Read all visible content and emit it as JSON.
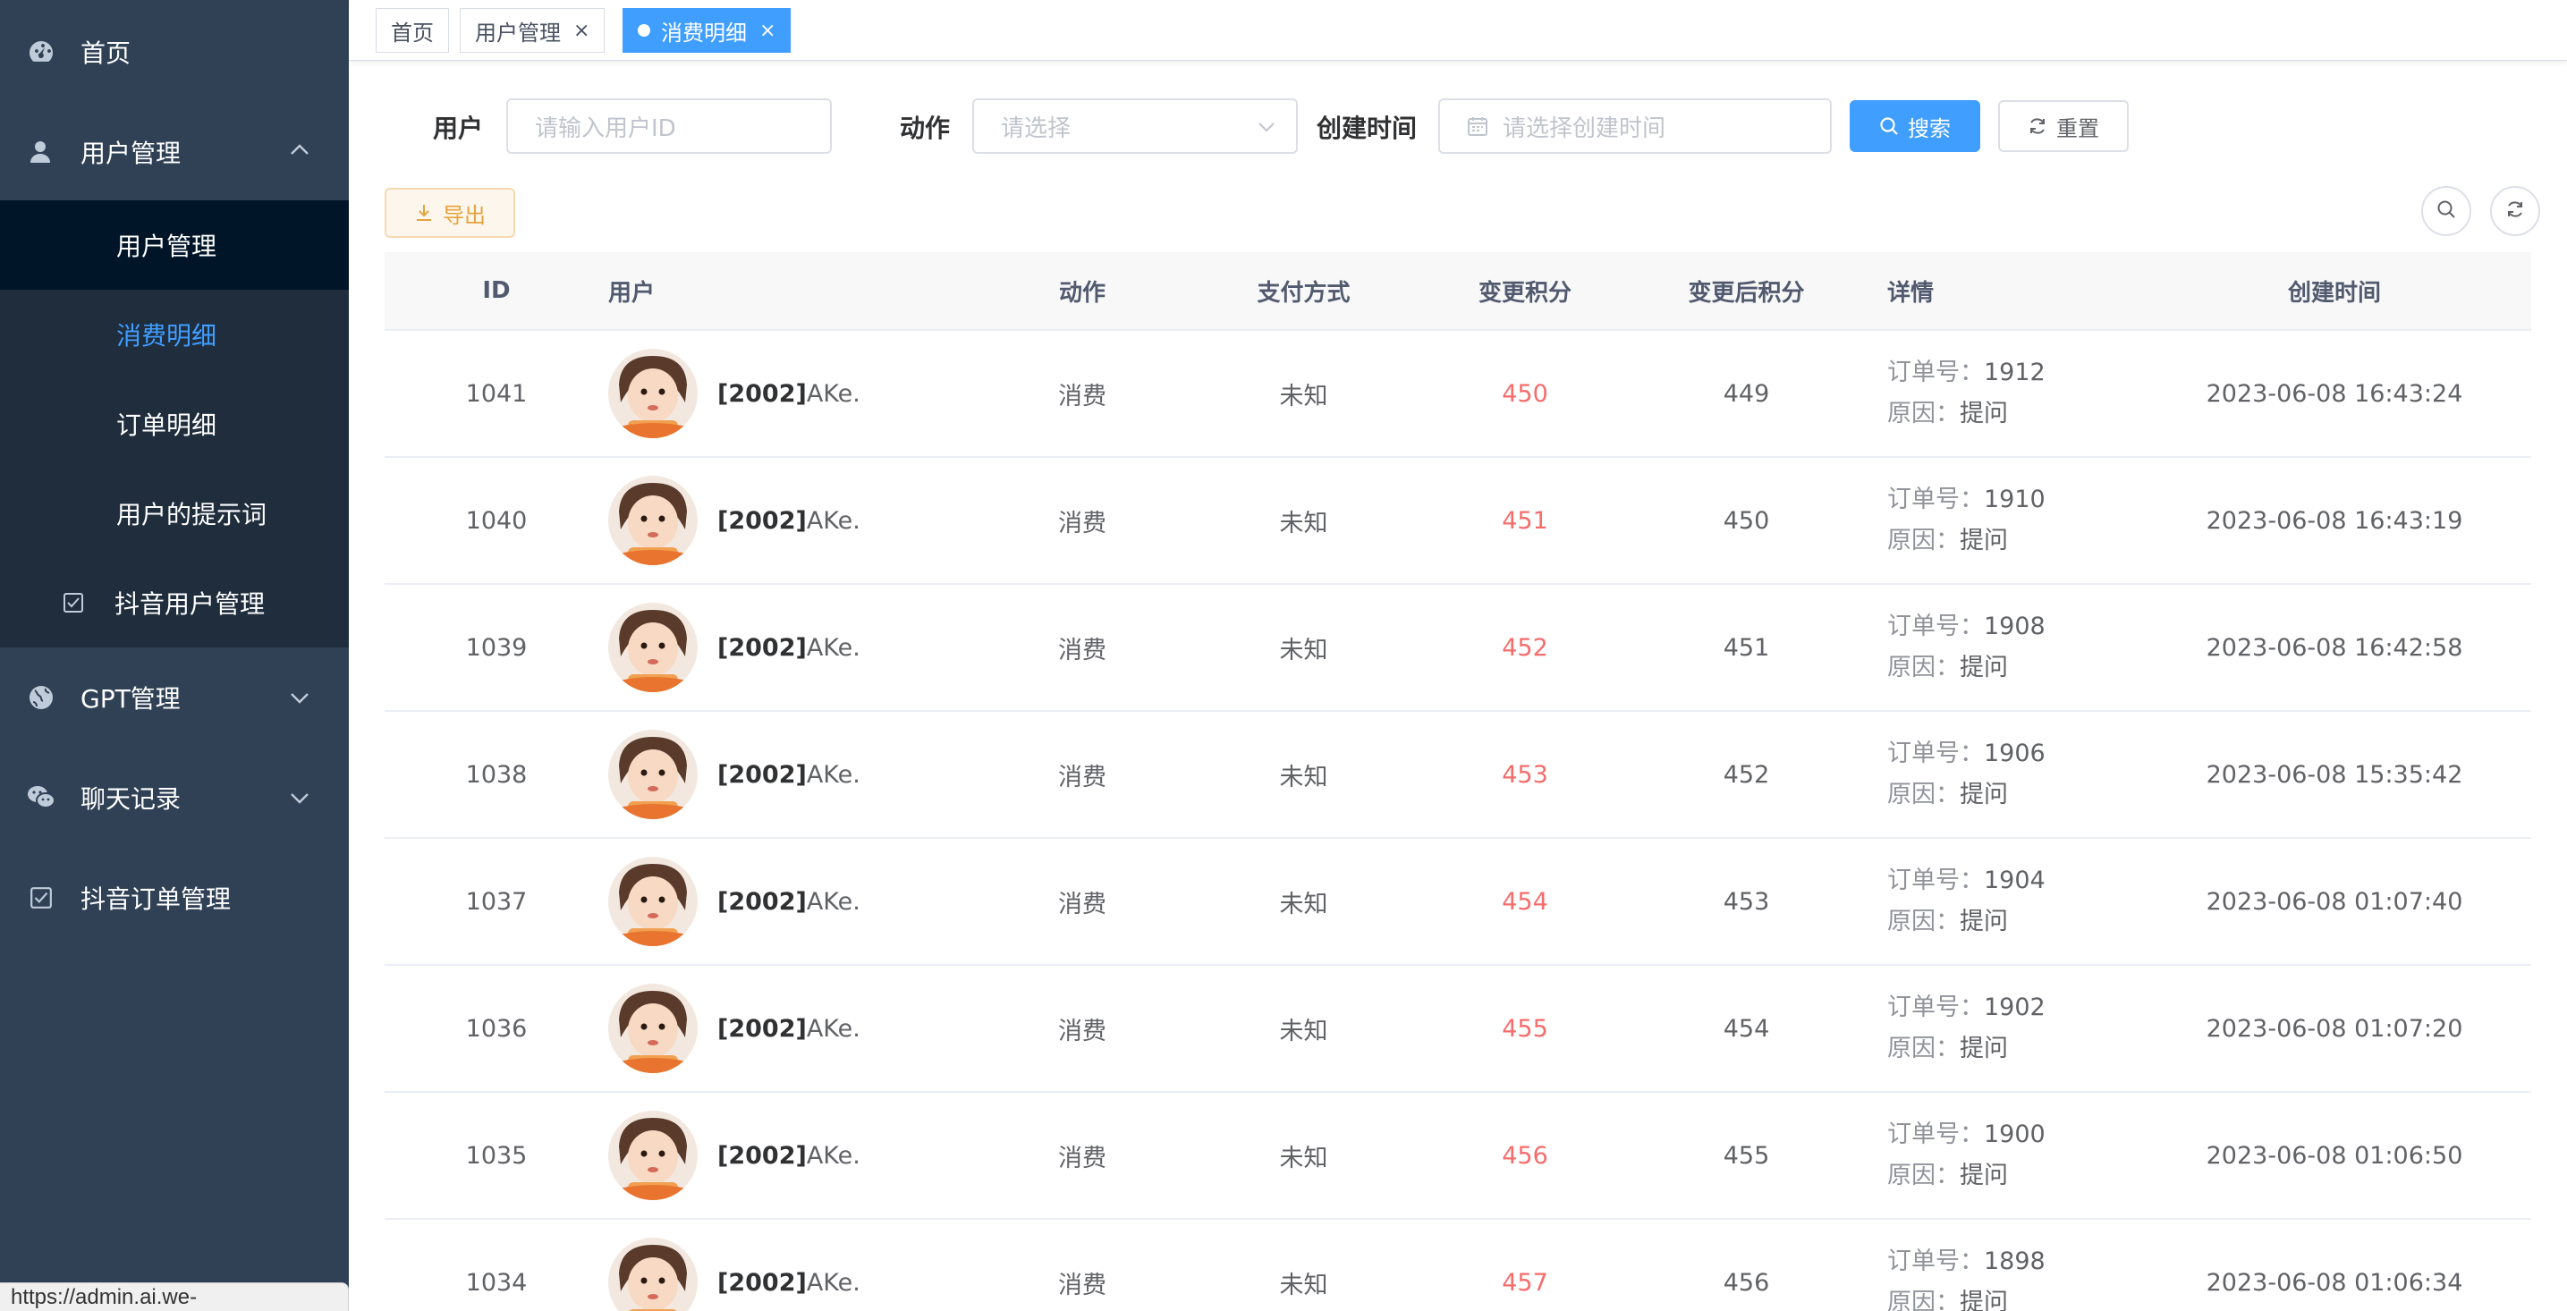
{
  "sidebar": {
    "home": "首页",
    "user_mgmt": "用户管理",
    "user_sub": [
      "用户管理",
      "消费明细",
      "订单明细",
      "用户的提示词"
    ],
    "douyin_user": "抖音用户管理",
    "gpt_mgmt": "GPT管理",
    "chat_records": "聊天记录",
    "douyin_order": "抖音订单管理"
  },
  "tabs": [
    {
      "label": "首页",
      "active": false
    },
    {
      "label": "用户管理",
      "active": false,
      "close": "×"
    },
    {
      "label": "消费明细",
      "active": true,
      "close": "×"
    }
  ],
  "search": {
    "user_label": "用户",
    "user_placeholder": "请输入用户ID",
    "action_label": "动作",
    "action_placeholder": "请选择",
    "time_label": "创建时间",
    "time_placeholder": "请选择创建时间",
    "search_btn": "搜索",
    "reset_btn": "重置"
  },
  "toolbar": {
    "export_btn": "导出"
  },
  "table": {
    "headers": [
      "ID",
      "用户",
      "动作",
      "支付方式",
      "变更积分",
      "变更后积分",
      "详情",
      "创建时间"
    ],
    "detail_keys": {
      "order": "订单号：",
      "reason": "原因："
    },
    "rows": [
      {
        "id": "1041",
        "user_id": "[2002]",
        "user_name": "AKe.",
        "action": "消费",
        "pay": "未知",
        "change": "450",
        "after": "449",
        "order": "1912",
        "reason": "提问",
        "time": "2023-06-08 16:43:24"
      },
      {
        "id": "1040",
        "user_id": "[2002]",
        "user_name": "AKe.",
        "action": "消费",
        "pay": "未知",
        "change": "451",
        "after": "450",
        "order": "1910",
        "reason": "提问",
        "time": "2023-06-08 16:43:19"
      },
      {
        "id": "1039",
        "user_id": "[2002]",
        "user_name": "AKe.",
        "action": "消费",
        "pay": "未知",
        "change": "452",
        "after": "451",
        "order": "1908",
        "reason": "提问",
        "time": "2023-06-08 16:42:58"
      },
      {
        "id": "1038",
        "user_id": "[2002]",
        "user_name": "AKe.",
        "action": "消费",
        "pay": "未知",
        "change": "453",
        "after": "452",
        "order": "1906",
        "reason": "提问",
        "time": "2023-06-08 15:35:42"
      },
      {
        "id": "1037",
        "user_id": "[2002]",
        "user_name": "AKe.",
        "action": "消费",
        "pay": "未知",
        "change": "454",
        "after": "453",
        "order": "1904",
        "reason": "提问",
        "time": "2023-06-08 01:07:40"
      },
      {
        "id": "1036",
        "user_id": "[2002]",
        "user_name": "AKe.",
        "action": "消费",
        "pay": "未知",
        "change": "455",
        "after": "454",
        "order": "1902",
        "reason": "提问",
        "time": "2023-06-08 01:07:20"
      },
      {
        "id": "1035",
        "user_id": "[2002]",
        "user_name": "AKe.",
        "action": "消费",
        "pay": "未知",
        "change": "456",
        "after": "455",
        "order": "1900",
        "reason": "提问",
        "time": "2023-06-08 01:06:50"
      },
      {
        "id": "1034",
        "user_id": "[2002]",
        "user_name": "AKe.",
        "action": "消费",
        "pay": "未知",
        "change": "457",
        "after": "456",
        "order": "1898",
        "reason": "提问",
        "time": "2023-06-08 01:06:34"
      }
    ]
  },
  "status_bar": {
    "url": "https://admin.ai.we-universe.cn/user/user"
  },
  "colors": {
    "sidebar": "#304156",
    "submenu": "#1f2d3d",
    "accent": "#409eff",
    "danger": "#f56c6c"
  }
}
